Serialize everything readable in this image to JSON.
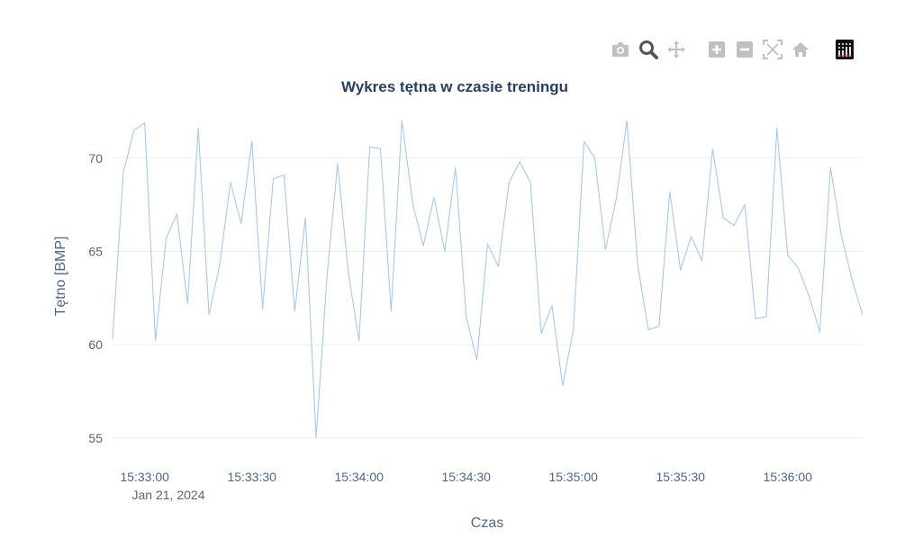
{
  "toolbar": {
    "buttons": [
      {
        "name": "camera-icon",
        "title": "Download plot as a png"
      },
      {
        "name": "zoom-icon",
        "title": "Zoom"
      },
      {
        "name": "pan-icon",
        "title": "Pan"
      },
      {
        "name": "zoom-in-icon",
        "title": "Zoom in"
      },
      {
        "name": "zoom-out-icon",
        "title": "Zoom out"
      },
      {
        "name": "autoscale-icon",
        "title": "Autoscale"
      },
      {
        "name": "reset-axes-icon",
        "title": "Reset axes"
      },
      {
        "name": "plotly-logo-icon",
        "title": "Produced with Plotly"
      }
    ],
    "active": "zoom-icon"
  },
  "chart_data": {
    "type": "line",
    "title": "Wykres tętna w czasie treningu",
    "xlabel": "Czas",
    "ylabel": "Tętno [BMP]",
    "x_date_label": "Jan 21, 2024",
    "x_tick_labels": [
      "15:33:00",
      "15:33:30",
      "15:34:00",
      "15:34:30",
      "15:35:00",
      "15:35:30",
      "15:36:00"
    ],
    "x_tick_values": [
      "2024-01-21 15:33:00",
      "2024-01-21 15:33:30",
      "2024-01-21 15:34:00",
      "2024-01-21 15:34:30",
      "2024-01-21 15:35:00",
      "2024-01-21 15:35:30",
      "2024-01-21 15:36:00"
    ],
    "xlim": [
      "2024-01-21 15:32:51",
      "2024-01-21 15:36:21"
    ],
    "y_ticks": [
      55,
      60,
      65,
      70
    ],
    "ylim": [
      54.9,
      72.4
    ],
    "grid": true,
    "series_color": "#a9c9e8",
    "x": [
      "2024-01-21 15:32:51",
      "2024-01-21 15:32:54",
      "2024-01-21 15:32:57",
      "2024-01-21 15:33:00",
      "2024-01-21 15:33:03",
      "2024-01-21 15:33:06",
      "2024-01-21 15:33:09",
      "2024-01-21 15:33:12",
      "2024-01-21 15:33:15",
      "2024-01-21 15:33:18",
      "2024-01-21 15:33:21",
      "2024-01-21 15:33:24",
      "2024-01-21 15:33:27",
      "2024-01-21 15:33:30",
      "2024-01-21 15:33:33",
      "2024-01-21 15:33:36",
      "2024-01-21 15:33:39",
      "2024-01-21 15:33:42",
      "2024-01-21 15:33:45",
      "2024-01-21 15:33:48",
      "2024-01-21 15:33:51",
      "2024-01-21 15:33:54",
      "2024-01-21 15:33:57",
      "2024-01-21 15:34:00",
      "2024-01-21 15:34:03",
      "2024-01-21 15:34:06",
      "2024-01-21 15:34:09",
      "2024-01-21 15:34:12",
      "2024-01-21 15:34:15",
      "2024-01-21 15:34:18",
      "2024-01-21 15:34:21",
      "2024-01-21 15:34:24",
      "2024-01-21 15:34:27",
      "2024-01-21 15:34:30",
      "2024-01-21 15:34:33",
      "2024-01-21 15:34:36",
      "2024-01-21 15:34:39",
      "2024-01-21 15:34:42",
      "2024-01-21 15:34:45",
      "2024-01-21 15:34:48",
      "2024-01-21 15:34:51",
      "2024-01-21 15:34:54",
      "2024-01-21 15:34:57",
      "2024-01-21 15:35:00",
      "2024-01-21 15:35:03",
      "2024-01-21 15:35:06",
      "2024-01-21 15:35:09",
      "2024-01-21 15:35:12",
      "2024-01-21 15:35:15",
      "2024-01-21 15:35:18",
      "2024-01-21 15:35:21",
      "2024-01-21 15:35:24",
      "2024-01-21 15:35:27",
      "2024-01-21 15:35:30",
      "2024-01-21 15:35:33",
      "2024-01-21 15:35:36",
      "2024-01-21 15:35:39",
      "2024-01-21 15:35:42",
      "2024-01-21 15:35:45",
      "2024-01-21 15:35:48",
      "2024-01-21 15:35:51",
      "2024-01-21 15:35:54",
      "2024-01-21 15:35:57",
      "2024-01-21 15:36:00",
      "2024-01-21 15:36:03",
      "2024-01-21 15:36:06",
      "2024-01-21 15:36:09",
      "2024-01-21 15:36:12",
      "2024-01-21 15:36:15",
      "2024-01-21 15:36:18",
      "2024-01-21 15:36:21"
    ],
    "values": [
      60.3,
      69.2,
      71.5,
      71.9,
      60.2,
      65.7,
      67.0,
      62.2,
      71.6,
      61.6,
      64.3,
      68.7,
      66.5,
      70.9,
      61.9,
      68.9,
      69.1,
      61.8,
      66.8,
      55.0,
      63.6,
      69.7,
      63.9,
      60.2,
      70.6,
      70.5,
      61.8,
      72.0,
      67.6,
      65.3,
      67.9,
      65.0,
      69.5,
      61.5,
      59.2,
      65.4,
      64.2,
      68.7,
      69.8,
      68.7,
      60.6,
      62.1,
      57.8,
      60.8,
      70.9,
      70.0,
      65.1,
      67.8,
      72.0,
      64.3,
      60.8,
      61.0,
      68.2,
      64.0,
      65.8,
      64.5,
      70.5,
      66.8,
      66.4,
      67.5,
      61.4,
      61.5,
      71.6,
      64.8,
      64.1,
      62.6,
      60.7,
      69.5,
      65.9,
      63.5,
      61.6
    ]
  }
}
